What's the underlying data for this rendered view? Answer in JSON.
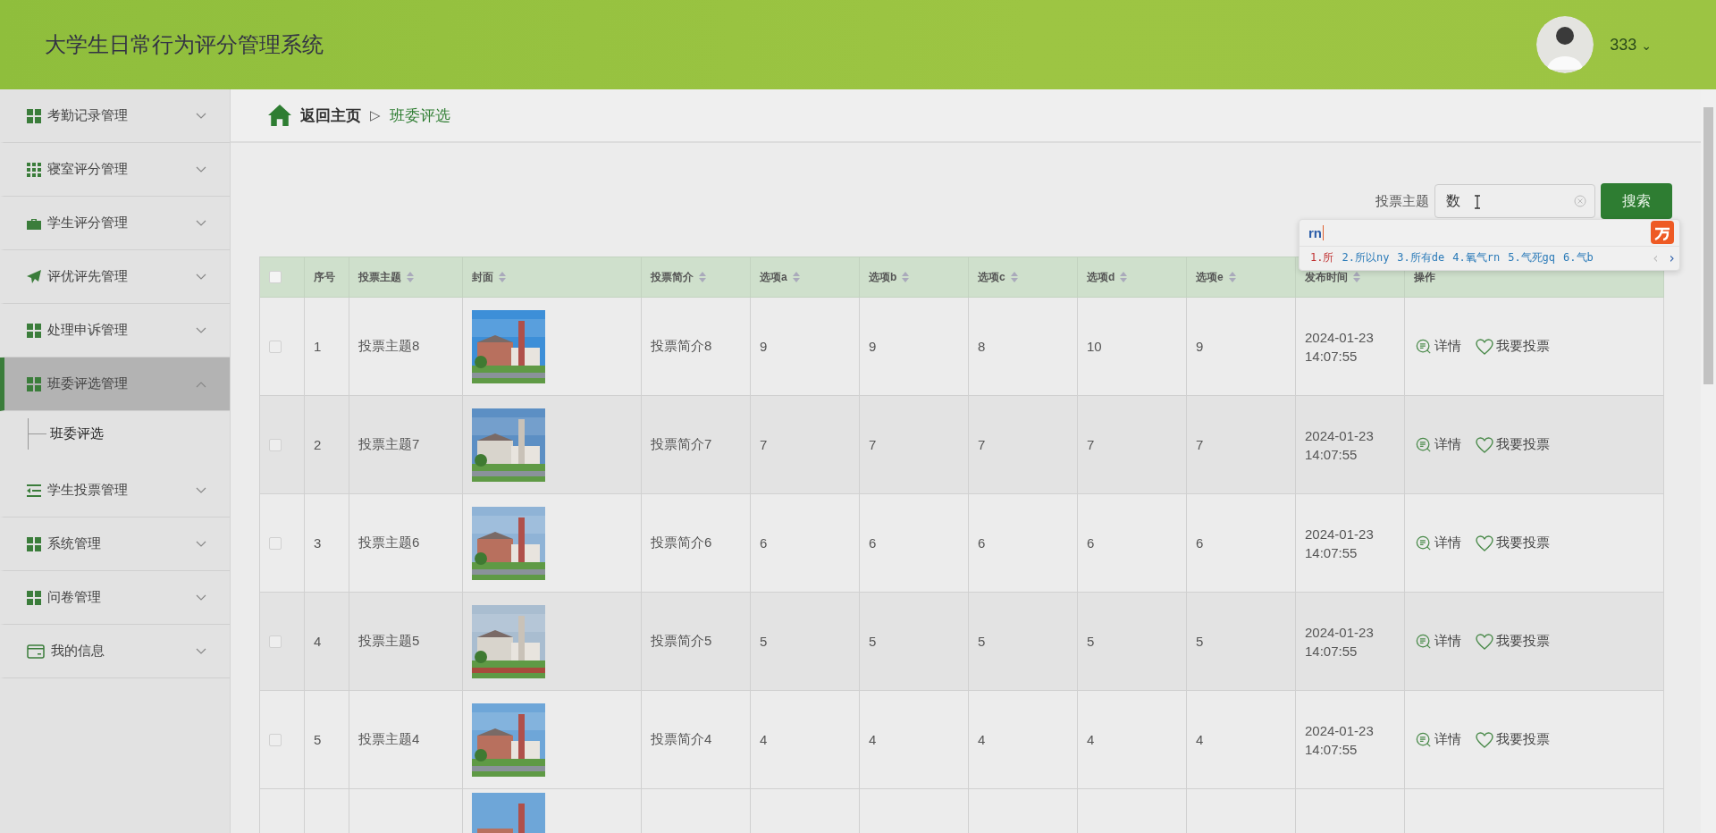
{
  "header": {
    "title": "大学生日常行为评分管理系统",
    "user": {
      "name": "333",
      "caret": "⌄"
    }
  },
  "sidebar": {
    "items": [
      {
        "label": "考勤记录管理",
        "kind": "grid",
        "expanded": false,
        "selected": false
      },
      {
        "label": "寝室评分管理",
        "kind": "dots",
        "expanded": false,
        "selected": false
      },
      {
        "label": "学生评分管理",
        "kind": "briefcase",
        "expanded": false,
        "selected": false
      },
      {
        "label": "评优评先管理",
        "kind": "plane",
        "expanded": false,
        "selected": false
      },
      {
        "label": "处理申诉管理",
        "kind": "grid",
        "expanded": false,
        "selected": false
      },
      {
        "label": "班委评选管理",
        "kind": "grid",
        "expanded": true,
        "selected": true,
        "children": [
          {
            "label": "班委评选",
            "selected": true
          }
        ]
      },
      {
        "label": "学生投票管理",
        "kind": "list",
        "expanded": false,
        "selected": false
      },
      {
        "label": "系统管理",
        "kind": "grid",
        "expanded": false,
        "selected": false
      },
      {
        "label": "问卷管理",
        "kind": "grid",
        "expanded": false,
        "selected": false
      },
      {
        "label": "我的信息",
        "kind": "card",
        "expanded": false,
        "selected": false
      }
    ]
  },
  "breadcrumb": {
    "home": "返回主页",
    "separator": "▷",
    "current": "班委评选"
  },
  "search": {
    "label": "投票主题",
    "value": "数",
    "button": "搜索"
  },
  "ime": {
    "input": "rn",
    "candidates": [
      {
        "text": "1.所",
        "selected": true
      },
      {
        "text": "2.所以ny",
        "selected": false
      },
      {
        "text": "3.所有de",
        "selected": false
      },
      {
        "text": "4.氧气rn",
        "selected": false
      },
      {
        "text": "5.气死gq",
        "selected": false
      },
      {
        "text": "6.气b",
        "selected": false
      }
    ],
    "prev": "‹",
    "next": "›"
  },
  "table": {
    "header_checkbox": {
      "checked": false
    },
    "columns": [
      {
        "label": "序号",
        "sortable": false
      },
      {
        "label": "投票主题",
        "sortable": true
      },
      {
        "label": "封面",
        "sortable": true
      },
      {
        "label": "投票简介",
        "sortable": true
      },
      {
        "label": "选项a",
        "sortable": true
      },
      {
        "label": "选项b",
        "sortable": true
      },
      {
        "label": "选项c",
        "sortable": true
      },
      {
        "label": "选项d",
        "sortable": true
      },
      {
        "label": "选项e",
        "sortable": true
      },
      {
        "label": "发布时间",
        "sortable": true
      },
      {
        "label": "操作",
        "sortable": false
      }
    ],
    "rows": [
      {
        "checked": false,
        "index": "1",
        "topic": "投票主题8",
        "intro": "投票简介8",
        "a": "9",
        "b": "9",
        "c": "8",
        "d": "10",
        "e": "9",
        "time": "2024-01-23 14:07:55",
        "actions": [
          "详情",
          "我要投票"
        ]
      },
      {
        "checked": false,
        "index": "2",
        "topic": "投票主题7",
        "intro": "投票简介7",
        "a": "7",
        "b": "7",
        "c": "7",
        "d": "7",
        "e": "7",
        "time": "2024-01-23 14:07:55",
        "actions": [
          "详情",
          "我要投票"
        ]
      },
      {
        "checked": false,
        "index": "3",
        "topic": "投票主题6",
        "intro": "投票简介6",
        "a": "6",
        "b": "6",
        "c": "6",
        "d": "6",
        "e": "6",
        "time": "2024-01-23 14:07:55",
        "actions": [
          "详情",
          "我要投票"
        ]
      },
      {
        "checked": false,
        "index": "4",
        "topic": "投票主题5",
        "intro": "投票简介5",
        "a": "5",
        "b": "5",
        "c": "5",
        "d": "5",
        "e": "5",
        "time": "2024-01-23 14:07:55",
        "actions": [
          "详情",
          "我要投票"
        ]
      },
      {
        "checked": false,
        "index": "5",
        "topic": "投票主题4",
        "intro": "投票简介4",
        "a": "4",
        "b": "4",
        "c": "4",
        "d": "4",
        "e": "4",
        "time": "2024-01-23 14:07:55",
        "actions": [
          "详情",
          "我要投票"
        ]
      }
    ]
  }
}
